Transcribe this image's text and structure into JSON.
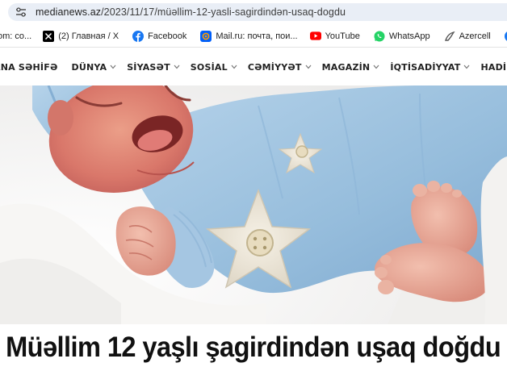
{
  "browser": {
    "url_host": "medianews.az",
    "url_path": "/2023/11/17/müəllim-12-yasli-sagirdindən-usaq-dogdu"
  },
  "bookmarks": [
    {
      "label": "om: co...",
      "icon": "none"
    },
    {
      "label": "(2) Главная / X",
      "icon": "x-icon"
    },
    {
      "label": "Facebook",
      "icon": "facebook-icon"
    },
    {
      "label": "Mail.ru: почта, пои...",
      "icon": "mailru-icon"
    },
    {
      "label": "YouTube",
      "icon": "youtube-icon"
    },
    {
      "label": "WhatsApp",
      "icon": "whatsapp-icon"
    },
    {
      "label": "Azercell",
      "icon": "azercell-icon"
    },
    {
      "label": "",
      "icon": "facebook-icon"
    }
  ],
  "nav": {
    "items": [
      {
        "label": "ANA SƏHİFƏ",
        "has_dropdown": false
      },
      {
        "label": "DÜNYA",
        "has_dropdown": true
      },
      {
        "label": "SİYASƏT",
        "has_dropdown": true
      },
      {
        "label": "SOSİAL",
        "has_dropdown": true
      },
      {
        "label": "CƏMİYYƏT",
        "has_dropdown": true
      },
      {
        "label": "MAGAZİN",
        "has_dropdown": true
      },
      {
        "label": "İQTİSADİYYAT",
        "has_dropdown": true
      },
      {
        "label": "HADİSƏ",
        "has_dropdown": true
      }
    ]
  },
  "article": {
    "headline": "Müəllim 12 yaşlı şagirdindən uşaq doğdu"
  },
  "colors": {
    "address_bg": "#e9eef6",
    "facebook": "#1877f2",
    "youtube": "#ff0000",
    "whatsapp": "#25d366",
    "mailru": "#ff9e00",
    "baby_outfit": "#9fc3e0"
  }
}
